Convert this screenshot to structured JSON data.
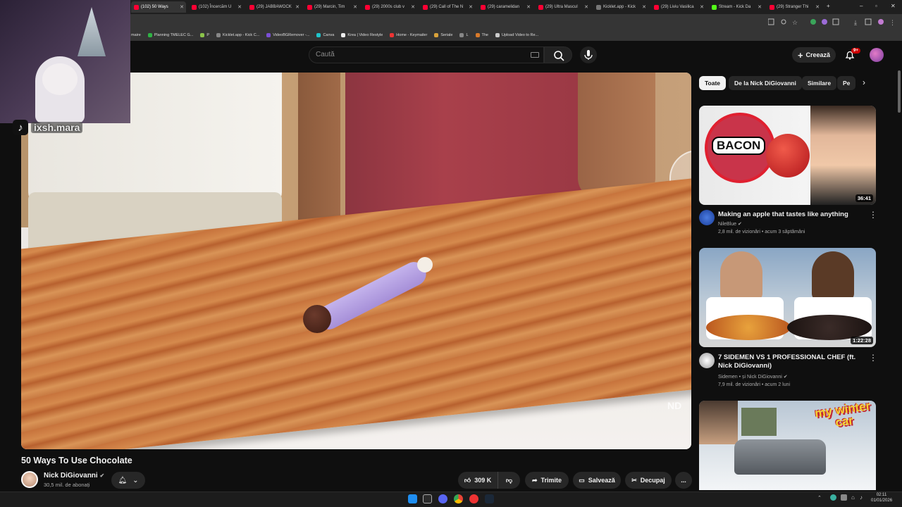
{
  "browser": {
    "tabs": [
      {
        "label": "(102) 50 Ways",
        "favicon": "youtube"
      },
      {
        "label": "(102) Încercăm U",
        "favicon": "youtube"
      },
      {
        "label": "(29) JABBAWOCK",
        "favicon": "youtube"
      },
      {
        "label": "(29) Marcin, Tim",
        "favicon": "youtube"
      },
      {
        "label": "(29) 2000s club v",
        "favicon": "youtube"
      },
      {
        "label": "(29) Call of The N",
        "favicon": "youtube"
      },
      {
        "label": "(29) caramelidan",
        "favicon": "youtube"
      },
      {
        "label": "(29) Ultra Mascul",
        "favicon": "youtube"
      },
      {
        "label": "Kicklet.app - Kick",
        "favicon": "kicklet"
      },
      {
        "label": "(29) Liviu Vasilica",
        "favicon": "youtube"
      },
      {
        "label": "Stream - Kick Da",
        "favicon": "kick"
      },
      {
        "label": "(29) Stranger Thi",
        "favicon": "youtube"
      }
    ],
    "bookmarks": [
      "maire",
      "Planning TMELEC G...",
      "P",
      "Kicklet.app - Kick C...",
      "VideoBGRemover -...",
      "Canva",
      "Krea | Video Restyle",
      "Home - Keymailer",
      "Seriale",
      "L",
      "The",
      "Upload Video to Re..."
    ]
  },
  "youtube": {
    "search_placeholder": "Caută",
    "create_label": "Creează",
    "notifications_count": "9+"
  },
  "overlay": {
    "tiktok_handle": "ixsh.mara"
  },
  "video": {
    "watermark": "ND",
    "title": "50 Ways To Use Chocolate",
    "channel": "Nick DiGiovanni",
    "subscribers": "30,5 mil. de abonați",
    "likes": "309 K",
    "share_label": "Trimite",
    "save_label": "Salvează",
    "clip_label": "Decupaj",
    "more_label": "..."
  },
  "sidebar": {
    "chips": [
      "Toate",
      "De la Nick DiGiovanni",
      "Similare",
      "Pe"
    ],
    "recommendations": [
      {
        "title": "Making an apple that tastes like anything",
        "channel": "NileBlue",
        "meta": "2,8 mil. de vizionări • acum 3 săptămâni",
        "duration": "36:41",
        "thumb_text": "BACON"
      },
      {
        "title": "7 SIDEMEN VS 1 PROFESSIONAL CHEF (ft. Nick DiGiovanni)",
        "channel": "Sidemen • și Nick DiGiovanni",
        "meta": "7,9 mil. de vizionări • acum 2 luni",
        "duration": "1:22:28"
      },
      {
        "title": "",
        "channel": "",
        "meta": "",
        "duration": "",
        "thumb_text": "my winter car"
      }
    ]
  },
  "taskbar": {
    "time": "02:11",
    "date": "01/01/2026"
  }
}
